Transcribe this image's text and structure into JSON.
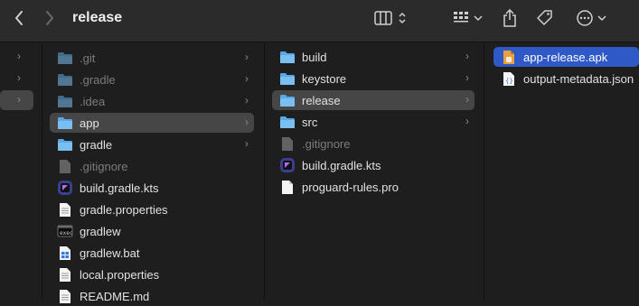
{
  "window": {
    "title": "release"
  },
  "toolbar": {
    "back_icon": "chevron-left-icon",
    "forward_icon": "chevron-right-icon",
    "view_icon": "column-view-icon",
    "group_icon": "group-grid-icon",
    "share_icon": "share-icon",
    "tag_icon": "tag-icon",
    "more_icon": "ellipsis-circle-icon"
  },
  "columns": [
    {
      "items": [
        {
          "label": "",
          "dim": false,
          "chev": true
        },
        {
          "label": "",
          "dim": false,
          "chev": true
        },
        {
          "label": "",
          "dim": false,
          "chev": true,
          "selected": "gray"
        }
      ]
    },
    {
      "items": [
        {
          "label": ".git",
          "icon": "folder-icon",
          "dim": true,
          "chev": true
        },
        {
          "label": ".gradle",
          "icon": "folder-icon",
          "dim": true,
          "chev": true
        },
        {
          "label": ".idea",
          "icon": "folder-icon",
          "dim": true,
          "chev": true
        },
        {
          "label": "app",
          "icon": "folder-icon",
          "dim": false,
          "chev": true,
          "selected": "gray"
        },
        {
          "label": "gradle",
          "icon": "folder-icon",
          "dim": false,
          "chev": true
        },
        {
          "label": ".gitignore",
          "icon": "file-icon",
          "dim": true,
          "chev": false
        },
        {
          "label": "build.gradle.kts",
          "icon": "kotlin-file-icon",
          "dim": false,
          "chev": false
        },
        {
          "label": "gradle.properties",
          "icon": "text-file-icon",
          "dim": false,
          "chev": false
        },
        {
          "label": "gradlew",
          "icon": "terminal-file-icon",
          "dim": false,
          "chev": false
        },
        {
          "label": "gradlew.bat",
          "icon": "windows-file-icon",
          "dim": false,
          "chev": false
        },
        {
          "label": "local.properties",
          "icon": "text-file-icon",
          "dim": false,
          "chev": false
        },
        {
          "label": "README.md",
          "icon": "text-file-icon",
          "dim": false,
          "chev": false
        }
      ]
    },
    {
      "items": [
        {
          "label": "build",
          "icon": "folder-icon",
          "dim": false,
          "chev": true
        },
        {
          "label": "keystore",
          "icon": "folder-icon",
          "dim": false,
          "chev": true
        },
        {
          "label": "release",
          "icon": "folder-icon",
          "dim": false,
          "chev": true,
          "selected": "gray"
        },
        {
          "label": "src",
          "icon": "folder-icon",
          "dim": false,
          "chev": true
        },
        {
          "label": ".gitignore",
          "icon": "file-icon",
          "dim": true,
          "chev": false
        },
        {
          "label": "build.gradle.kts",
          "icon": "kotlin-file-icon",
          "dim": false,
          "chev": false
        },
        {
          "label": "proguard-rules.pro",
          "icon": "blank-file-icon",
          "dim": false,
          "chev": false
        }
      ]
    },
    {
      "items": [
        {
          "label": "app-release.apk",
          "icon": "apk-file-icon",
          "dim": false,
          "chev": false,
          "selected": "blue"
        },
        {
          "label": "output-metadata.json",
          "icon": "json-file-icon",
          "dim": false,
          "chev": false
        }
      ]
    }
  ],
  "colors": {
    "folder": "#5aa8e6",
    "selection_blue": "#2f59c7",
    "selection_gray": "#464646"
  }
}
